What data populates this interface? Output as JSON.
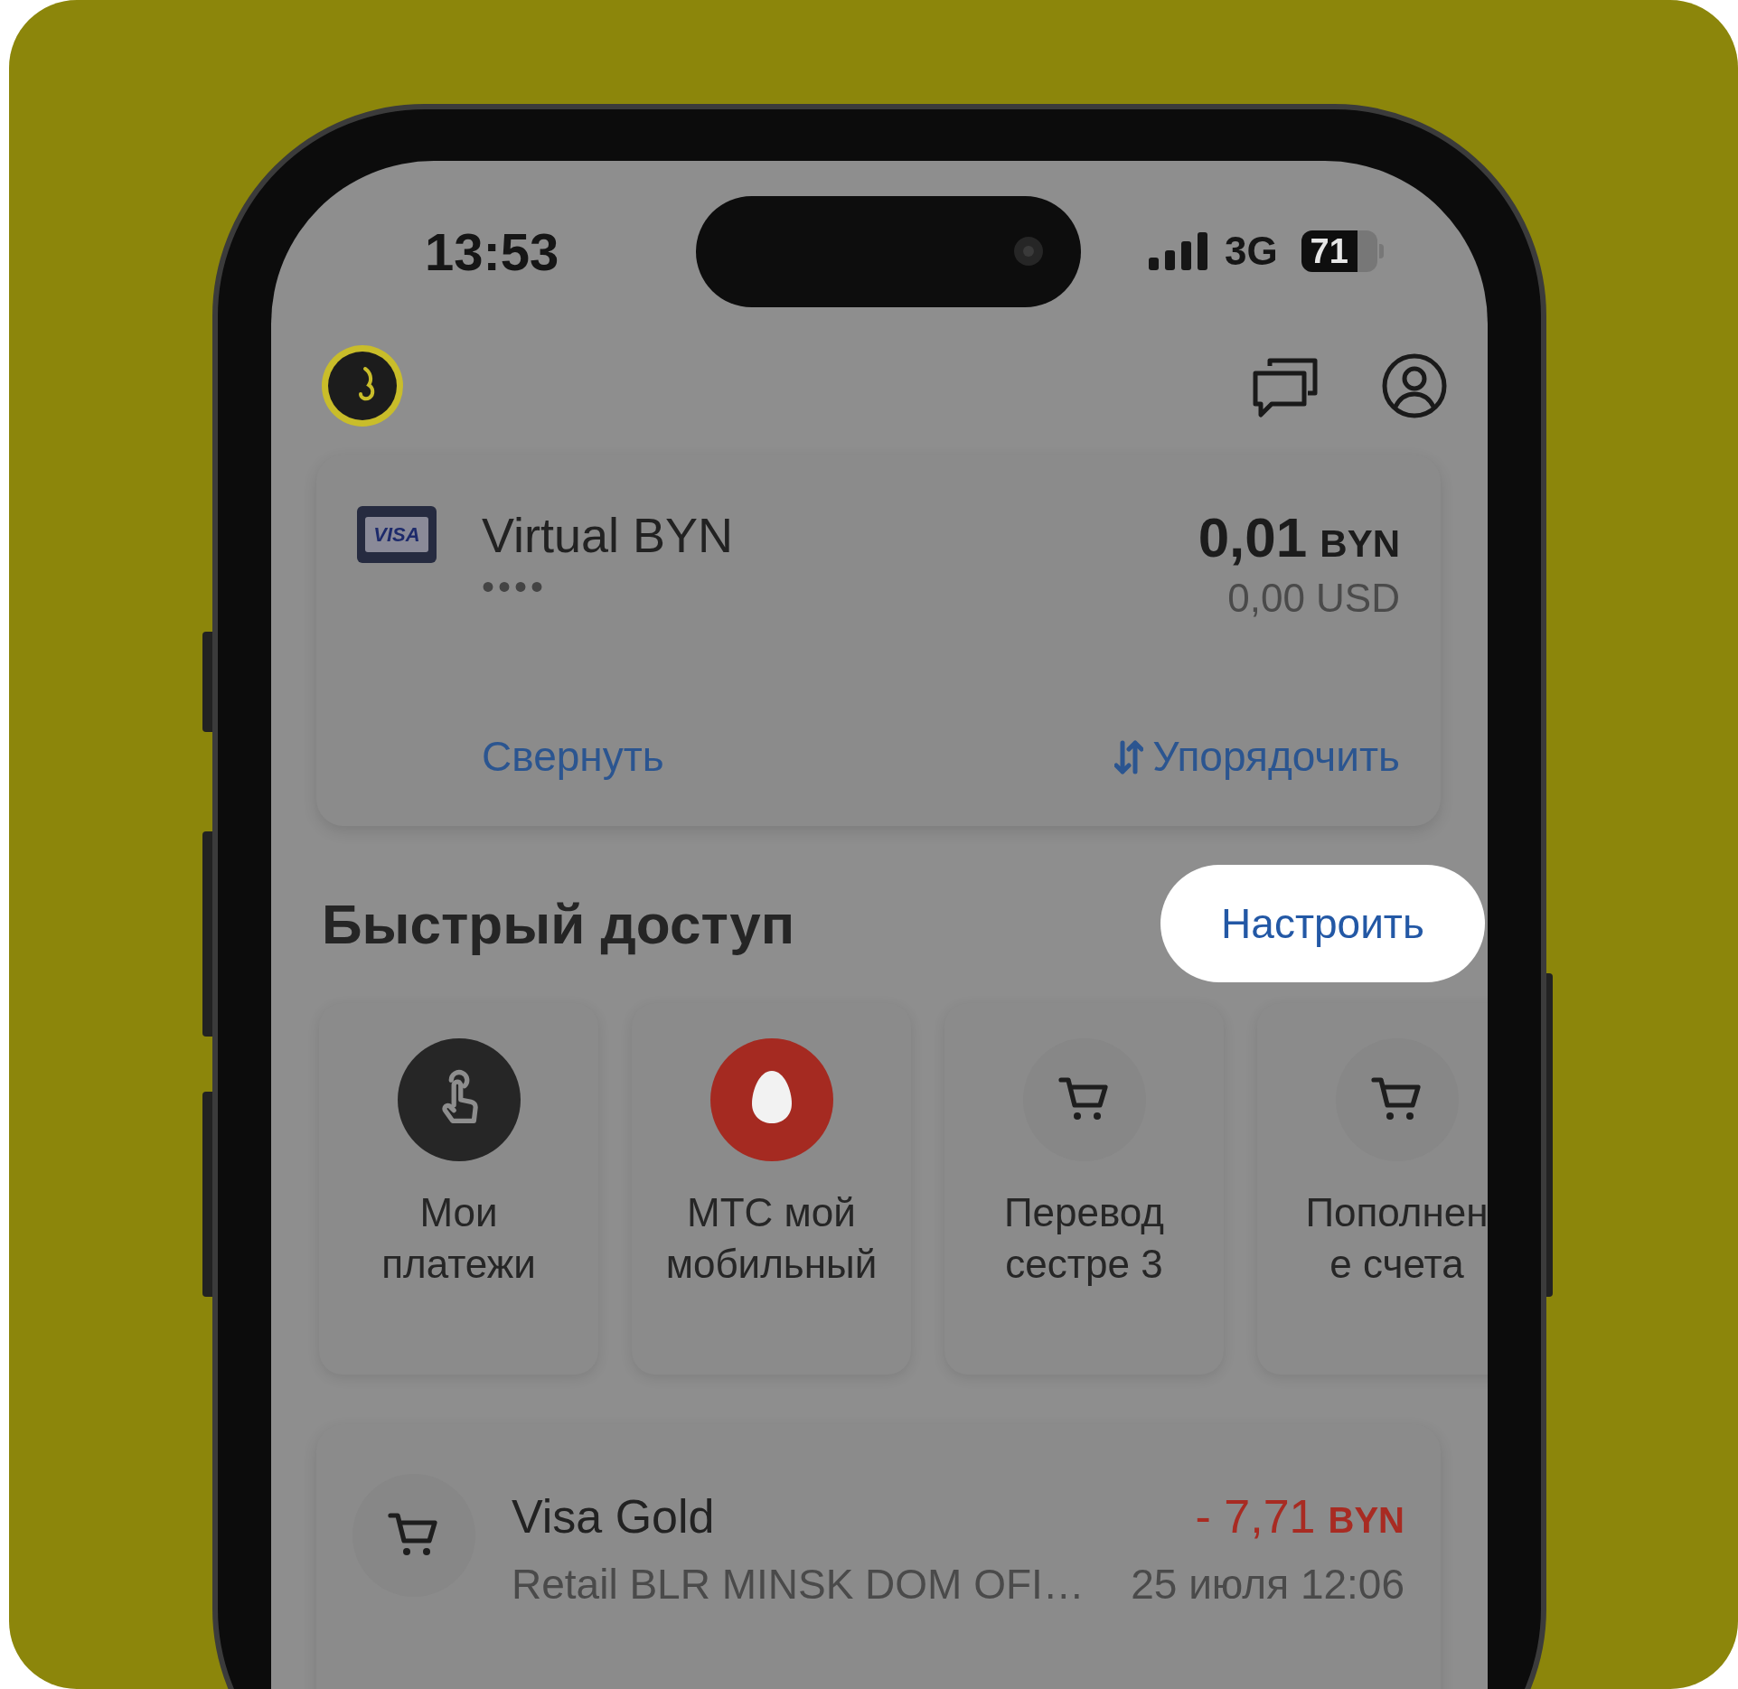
{
  "status_bar": {
    "time": "13:53",
    "network": "3G",
    "battery": "71"
  },
  "account_card": {
    "card_brand": "VISA",
    "name": "Virtual BYN",
    "masked_number": "••••",
    "balance": "0,01",
    "balance_currency": "BYN",
    "balance_converted": "0,00 USD",
    "collapse_link": "Свернуть",
    "sort_link": "Упорядочить"
  },
  "quick_access": {
    "title": "Быстрый доступ",
    "customize_button": "Настроить",
    "tiles": [
      {
        "kind": "payments",
        "lines": [
          "Мои",
          "платежи"
        ]
      },
      {
        "kind": "mts",
        "lines": [
          "МТС мой",
          "мобильный"
        ]
      },
      {
        "kind": "cart",
        "lines": [
          "Перевод",
          "сестре 3"
        ]
      },
      {
        "kind": "cart",
        "lines": [
          "Пополнен",
          "е счета"
        ]
      }
    ]
  },
  "transaction": {
    "account": "Visa Gold",
    "description": "Retail BLR MINSK DOM OFI…",
    "amount": "- 7,71",
    "currency": "BYN",
    "date": "25 июля 12:06"
  }
}
